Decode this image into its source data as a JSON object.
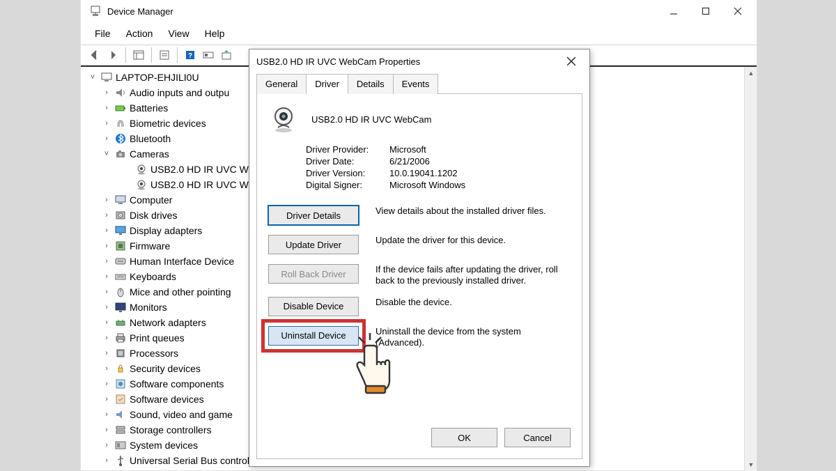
{
  "window": {
    "title": "Device Manager",
    "menus": [
      "File",
      "Action",
      "View",
      "Help"
    ]
  },
  "tree": {
    "root": "LAPTOP-EHJILI0U",
    "items": [
      {
        "label": "Audio inputs and outpu",
        "exp": ">",
        "icon": "audio"
      },
      {
        "label": "Batteries",
        "exp": ">",
        "icon": "battery"
      },
      {
        "label": "Biometric devices",
        "exp": ">",
        "icon": "biometric"
      },
      {
        "label": "Bluetooth",
        "exp": ">",
        "icon": "bluetooth"
      },
      {
        "label": "Cameras",
        "exp": "v",
        "icon": "camera",
        "children": [
          {
            "label": "USB2.0 HD IR UVC W",
            "icon": "webcam"
          },
          {
            "label": "USB2.0 HD IR UVC W",
            "icon": "webcam"
          }
        ]
      },
      {
        "label": "Computer",
        "exp": ">",
        "icon": "computer"
      },
      {
        "label": "Disk drives",
        "exp": ">",
        "icon": "disk"
      },
      {
        "label": "Display adapters",
        "exp": ">",
        "icon": "display"
      },
      {
        "label": "Firmware",
        "exp": ">",
        "icon": "firmware"
      },
      {
        "label": "Human Interface Device",
        "exp": ">",
        "icon": "hid"
      },
      {
        "label": "Keyboards",
        "exp": ">",
        "icon": "keyboard"
      },
      {
        "label": "Mice and other pointing",
        "exp": ">",
        "icon": "mouse"
      },
      {
        "label": "Monitors",
        "exp": ">",
        "icon": "monitor"
      },
      {
        "label": "Network adapters",
        "exp": ">",
        "icon": "network"
      },
      {
        "label": "Print queues",
        "exp": ">",
        "icon": "printer"
      },
      {
        "label": "Processors",
        "exp": ">",
        "icon": "cpu"
      },
      {
        "label": "Security devices",
        "exp": ">",
        "icon": "security"
      },
      {
        "label": "Software components",
        "exp": ">",
        "icon": "swcomp"
      },
      {
        "label": "Software devices",
        "exp": ">",
        "icon": "swdev"
      },
      {
        "label": "Sound, video and game",
        "exp": ">",
        "icon": "sound"
      },
      {
        "label": "Storage controllers",
        "exp": ">",
        "icon": "storage"
      },
      {
        "label": "System devices",
        "exp": ">",
        "icon": "system"
      },
      {
        "label": "Universal Serial Bus controllers",
        "exp": ">",
        "icon": "usb"
      }
    ]
  },
  "dialog": {
    "title": "USB2.0 HD IR UVC WebCam Properties",
    "tabs": [
      "General",
      "Driver",
      "Details",
      "Events"
    ],
    "active_tab": "Driver",
    "device_name": "USB2.0 HD IR UVC WebCam",
    "info": [
      {
        "label": "Driver Provider:",
        "value": "Microsoft"
      },
      {
        "label": "Driver Date:",
        "value": "6/21/2006"
      },
      {
        "label": "Driver Version:",
        "value": "10.0.19041.1202"
      },
      {
        "label": "Digital Signer:",
        "value": "Microsoft Windows"
      }
    ],
    "actions": [
      {
        "label": "Driver Details",
        "desc": "View details about the installed driver files.",
        "state": "focus"
      },
      {
        "label": "Update Driver",
        "desc": "Update the driver for this device.",
        "state": ""
      },
      {
        "label": "Roll Back Driver",
        "desc": "If the device fails after updating the driver, roll back to the previously installed driver.",
        "state": "disabled"
      },
      {
        "label": "Disable Device",
        "desc": "Disable the device.",
        "state": ""
      },
      {
        "label": "Uninstall Device",
        "desc": "Uninstall the device from the system (Advanced).",
        "state": "selected highlight"
      }
    ],
    "ok": "OK",
    "cancel": "Cancel"
  }
}
